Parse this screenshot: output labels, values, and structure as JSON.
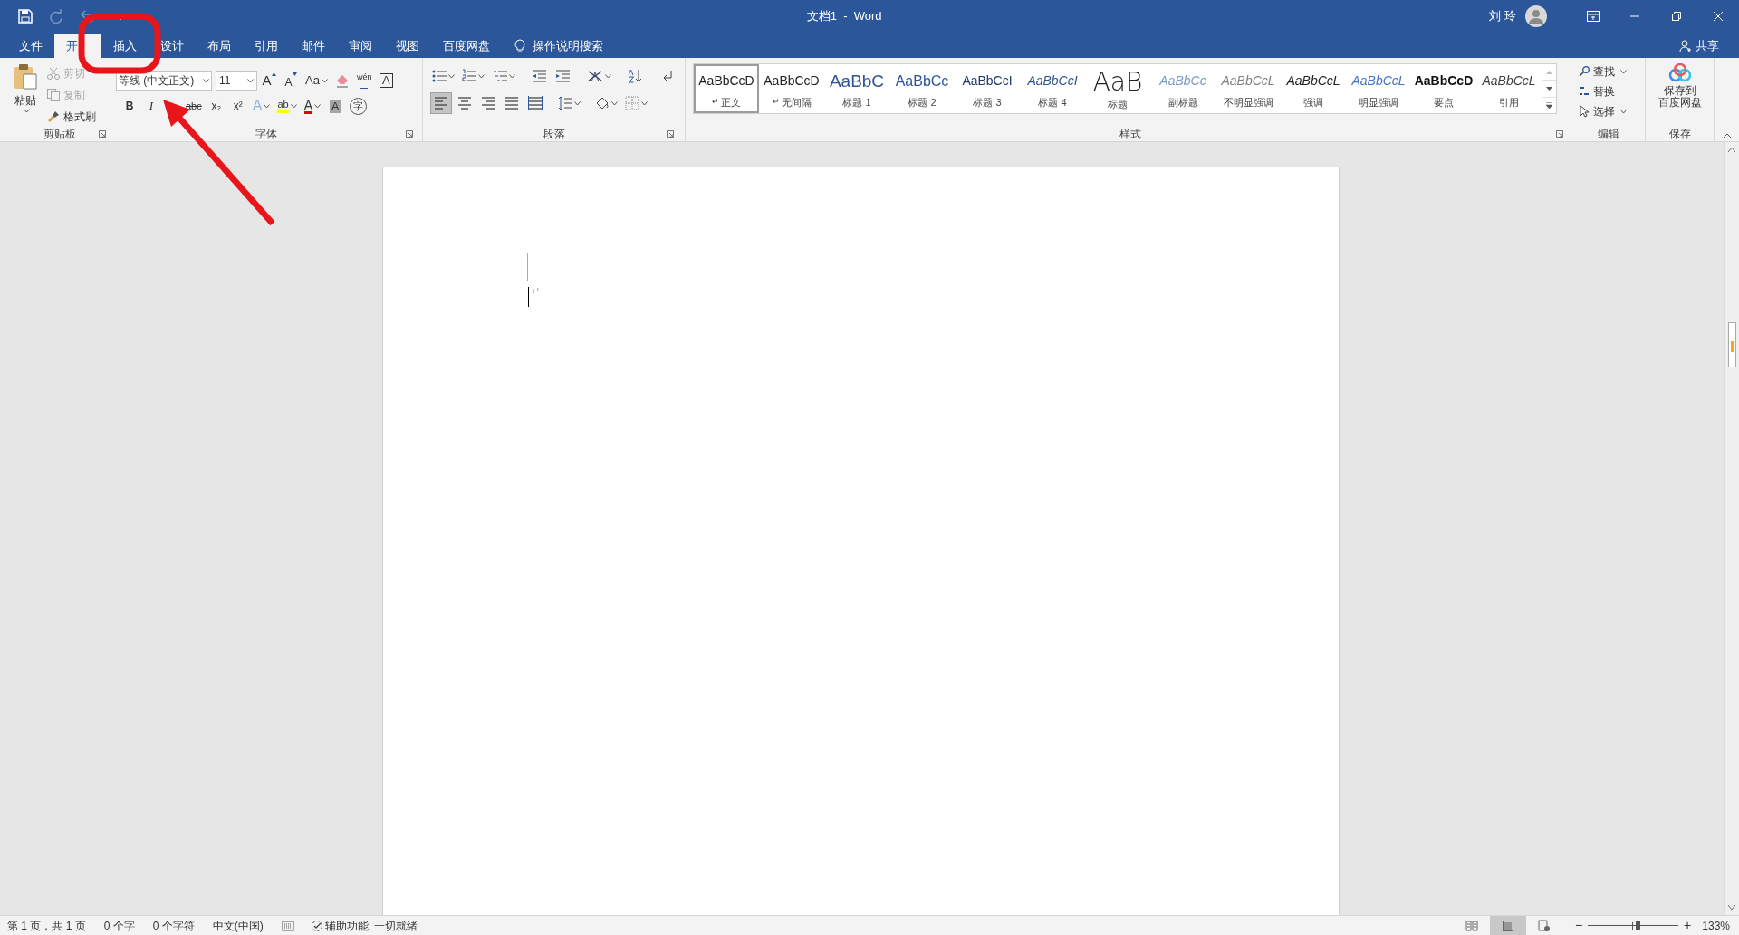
{
  "title_bar": {
    "title": "文档1  -  Word",
    "user": "刘 玲"
  },
  "tabs": [
    {
      "label": "文件",
      "selected": false
    },
    {
      "label": "开",
      "selected": true
    },
    {
      "label": "插入",
      "selected": false
    },
    {
      "label": "设计",
      "selected": false
    },
    {
      "label": "布局",
      "selected": false
    },
    {
      "label": "引用",
      "selected": false
    },
    {
      "label": "邮件",
      "selected": false
    },
    {
      "label": "审阅",
      "selected": false
    },
    {
      "label": "视图",
      "selected": false
    },
    {
      "label": "百度网盘",
      "selected": false
    }
  ],
  "tell_me": "操作说明搜索",
  "share": "共享",
  "clipboard": {
    "paste": "粘贴",
    "items": [
      {
        "kind": "cut",
        "label": "剪切",
        "disabled": true
      },
      {
        "kind": "copy",
        "label": "复制",
        "disabled": true
      },
      {
        "kind": "brush",
        "label": "格式刷",
        "disabled": false
      }
    ],
    "group": "剪贴板"
  },
  "font": {
    "name": "等线 (中文正文)",
    "size": "11",
    "group": "字体",
    "row1": [
      {
        "kind": "grow",
        "text": "A"
      },
      {
        "kind": "shrink",
        "text": "A"
      },
      {
        "kind": "case",
        "text": "Aa"
      },
      {
        "kind": "clear"
      },
      {
        "kind": "phonetic",
        "text": "wén"
      },
      {
        "kind": "border",
        "text": "A"
      }
    ],
    "row2": [
      {
        "kind": "bold",
        "text": "B"
      },
      {
        "kind": "italic",
        "text": "I"
      },
      {
        "kind": "strike",
        "text": "abc"
      },
      {
        "kind": "sub",
        "text": "x₂"
      },
      {
        "kind": "sup",
        "text": "x²"
      },
      {
        "kind": "effects",
        "text": "A"
      },
      {
        "kind": "highlight",
        "text": "ab"
      },
      {
        "kind": "color",
        "text": "A"
      },
      {
        "kind": "shading",
        "text": "A"
      },
      {
        "kind": "enclose",
        "text": "字"
      }
    ]
  },
  "paragraph": {
    "group": "段落",
    "alignments": [
      {
        "kind": "left",
        "selected": true
      },
      {
        "kind": "center",
        "selected": false
      },
      {
        "kind": "right",
        "selected": false
      },
      {
        "kind": "justify",
        "selected": false
      },
      {
        "kind": "distributed",
        "selected": false
      }
    ]
  },
  "styles": {
    "group": "样式",
    "items": [
      {
        "kind": "normal",
        "preview": "AaBbCcD",
        "mark": "↵",
        "label": "正文",
        "selected": true
      },
      {
        "kind": "normal",
        "preview": "AaBbCcD",
        "mark": "↵",
        "label": "无间隔",
        "selected": false
      },
      {
        "kind": "h1",
        "preview": "AaBbC",
        "label": "标题 1",
        "selected": false
      },
      {
        "kind": "h2",
        "preview": "AaBbCc",
        "label": "标题 2",
        "selected": false
      },
      {
        "kind": "h3",
        "preview": "AaBbCcI",
        "label": "标题 3",
        "selected": false
      },
      {
        "kind": "h4",
        "preview": "AaBbCcI",
        "label": "标题 4",
        "selected": false
      },
      {
        "kind": "title",
        "preview": "AaB",
        "label": "标题",
        "selected": false
      },
      {
        "kind": "subtitle",
        "preview": "AaBbCc",
        "label": "副标题",
        "selected": false
      },
      {
        "kind": "subtle",
        "preview": "AaBbCcL",
        "label": "不明显强调",
        "selected": false
      },
      {
        "kind": "emphasis",
        "preview": "AaBbCcL",
        "label": "强调",
        "selected": false
      },
      {
        "kind": "intense",
        "preview": "AaBbCcL",
        "label": "明显强调",
        "selected": false
      },
      {
        "kind": "strong",
        "preview": "AaBbCcD",
        "label": "要点",
        "selected": false
      },
      {
        "kind": "quote",
        "preview": "AaBbCcL",
        "label": "引用",
        "selected": false
      }
    ]
  },
  "editing": {
    "group": "编辑",
    "items": [
      {
        "kind": "find",
        "label": "查找"
      },
      {
        "kind": "replace",
        "label": "替换"
      },
      {
        "kind": "select",
        "label": "选择"
      }
    ]
  },
  "save": {
    "label_lines": [
      "保存到",
      "百度网盘"
    ],
    "group": "保存"
  },
  "document": {
    "mark": "↵"
  },
  "status_bar": {
    "items": [
      "第 1 页，共 1 页",
      "0 个字",
      "0 个字符",
      "中文(中国)"
    ],
    "accessibility": "辅助功能: 一切就绪",
    "views": [
      {
        "kind": "read",
        "selected": false
      },
      {
        "kind": "print",
        "selected": true
      },
      {
        "kind": "web",
        "selected": false
      }
    ],
    "zoom": {
      "minus": "−",
      "plus": "+",
      "level": 0.55,
      "reading": "133%"
    }
  }
}
